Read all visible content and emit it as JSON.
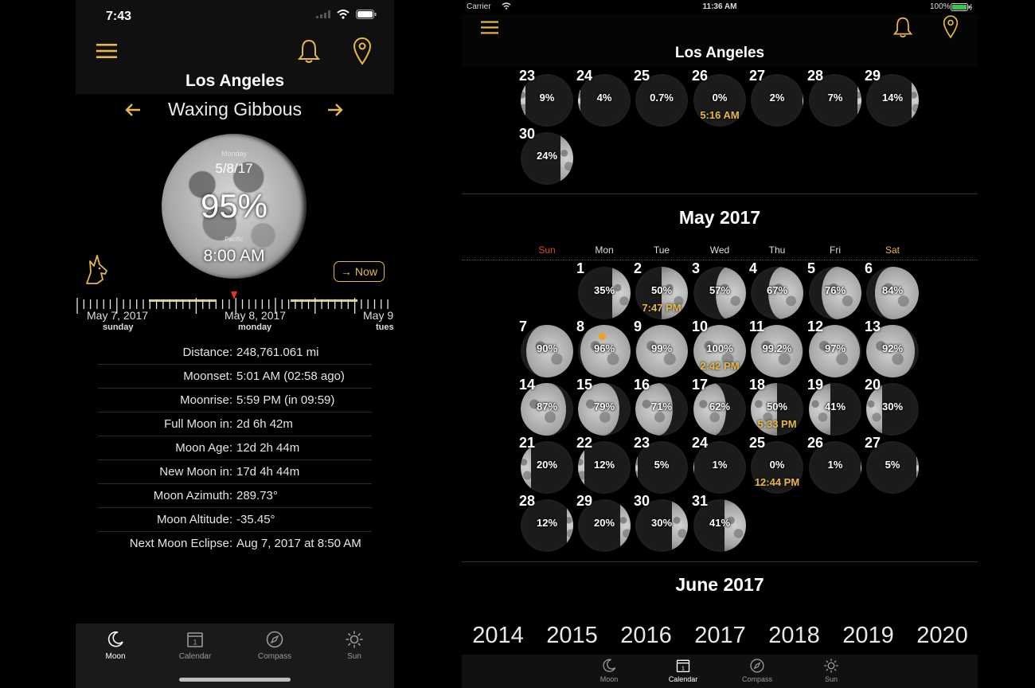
{
  "phone": {
    "status": {
      "time": "7:43"
    },
    "city": "Los Angeles",
    "phase": "Waxing Gibbous",
    "moon": {
      "day": "Monday",
      "date": "5/8/17",
      "illumination": "95%",
      "timezone": "Pacific",
      "time": "8:00 AM"
    },
    "now_button": "→ Now",
    "timeline": [
      {
        "date": "May 7, 2017",
        "day": "sunday"
      },
      {
        "date": "May 8, 2017",
        "day": "monday"
      },
      {
        "date": "May 9",
        "day": "tues"
      }
    ],
    "info": [
      {
        "label": "Distance:",
        "value": "248,761.061 mi"
      },
      {
        "label": "Moonset:",
        "value": "5:01 AM (02:58 ago)"
      },
      {
        "label": "Moonrise:",
        "value": "5:59 PM (in 09:59)"
      },
      {
        "label": "Full Moon in:",
        "value": "2d 6h 42m"
      },
      {
        "label": "Moon Age:",
        "value": "12d 2h 44m"
      },
      {
        "label": "New Moon in:",
        "value": "17d 4h 44m"
      },
      {
        "label": "Moon Azimuth:",
        "value": "289.73°"
      },
      {
        "label": "Moon Altitude:",
        "value": "-35.45°"
      },
      {
        "label": "Next Moon Eclipse:",
        "value": "Aug 7, 2017 at 8:50 AM"
      }
    ],
    "tabs": [
      {
        "label": "Moon",
        "icon": "moon-icon",
        "active": true
      },
      {
        "label": "Calendar",
        "icon": "calendar-icon",
        "active": false
      },
      {
        "label": "Compass",
        "icon": "compass-icon",
        "active": false
      },
      {
        "label": "Sun",
        "icon": "sun-icon",
        "active": false
      }
    ]
  },
  "tablet": {
    "status": {
      "carrier": "Carrier",
      "time": "11:36 AM",
      "battery": "100%"
    },
    "city": "Los Angeles",
    "april_tail": [
      {
        "day": "23",
        "pct": "9%",
        "illum": 0.09,
        "wax": false
      },
      {
        "day": "24",
        "pct": "4%",
        "illum": 0.04,
        "wax": false
      },
      {
        "day": "25",
        "pct": "0.7%",
        "illum": 0.007,
        "wax": false
      },
      {
        "day": "26",
        "pct": "0%",
        "illum": 0.0,
        "wax": true,
        "time": "5:16 AM"
      },
      {
        "day": "27",
        "pct": "2%",
        "illum": 0.02,
        "wax": true
      },
      {
        "day": "28",
        "pct": "7%",
        "illum": 0.07,
        "wax": true
      },
      {
        "day": "29",
        "pct": "14%",
        "illum": 0.14,
        "wax": true
      },
      {
        "day": "30",
        "pct": "24%",
        "illum": 0.24,
        "wax": true
      }
    ],
    "may": {
      "title": "May 2017",
      "weekdays": [
        "Sun",
        "Mon",
        "Tue",
        "Wed",
        "Thu",
        "Fri",
        "Sat"
      ],
      "first_weekday": 1,
      "days": [
        {
          "day": "1",
          "pct": "35%",
          "illum": 0.35,
          "wax": true
        },
        {
          "day": "2",
          "pct": "50%",
          "illum": 0.5,
          "wax": true,
          "time": "7:47 PM"
        },
        {
          "day": "3",
          "pct": "57%",
          "illum": 0.57,
          "wax": true
        },
        {
          "day": "4",
          "pct": "67%",
          "illum": 0.67,
          "wax": true
        },
        {
          "day": "5",
          "pct": "76%",
          "illum": 0.76,
          "wax": true
        },
        {
          "day": "6",
          "pct": "84%",
          "illum": 0.84,
          "wax": true
        },
        {
          "day": "7",
          "pct": "90%",
          "illum": 0.9,
          "wax": true
        },
        {
          "day": "8",
          "pct": "96%",
          "illum": 0.96,
          "wax": true,
          "today": true
        },
        {
          "day": "9",
          "pct": "99%",
          "illum": 0.99,
          "wax": true
        },
        {
          "day": "10",
          "pct": "100%",
          "illum": 1.0,
          "wax": true,
          "time": "2:42 PM"
        },
        {
          "day": "11",
          "pct": "99.2%",
          "illum": 0.99,
          "wax": false
        },
        {
          "day": "12",
          "pct": "97%",
          "illum": 0.97,
          "wax": false
        },
        {
          "day": "13",
          "pct": "92%",
          "illum": 0.92,
          "wax": false
        },
        {
          "day": "14",
          "pct": "87%",
          "illum": 0.87,
          "wax": false
        },
        {
          "day": "15",
          "pct": "79%",
          "illum": 0.79,
          "wax": false
        },
        {
          "day": "16",
          "pct": "71%",
          "illum": 0.71,
          "wax": false
        },
        {
          "day": "17",
          "pct": "62%",
          "illum": 0.62,
          "wax": false
        },
        {
          "day": "18",
          "pct": "50%",
          "illum": 0.5,
          "wax": false,
          "time": "5:33 PM"
        },
        {
          "day": "19",
          "pct": "41%",
          "illum": 0.41,
          "wax": false
        },
        {
          "day": "20",
          "pct": "30%",
          "illum": 0.3,
          "wax": false
        },
        {
          "day": "21",
          "pct": "20%",
          "illum": 0.2,
          "wax": false
        },
        {
          "day": "22",
          "pct": "12%",
          "illum": 0.12,
          "wax": false
        },
        {
          "day": "23",
          "pct": "5%",
          "illum": 0.05,
          "wax": false
        },
        {
          "day": "24",
          "pct": "1%",
          "illum": 0.01,
          "wax": false
        },
        {
          "day": "25",
          "pct": "0%",
          "illum": 0.0,
          "wax": true,
          "time": "12:44 PM"
        },
        {
          "day": "26",
          "pct": "1%",
          "illum": 0.01,
          "wax": true
        },
        {
          "day": "27",
          "pct": "5%",
          "illum": 0.05,
          "wax": true
        },
        {
          "day": "28",
          "pct": "12%",
          "illum": 0.12,
          "wax": true
        },
        {
          "day": "29",
          "pct": "20%",
          "illum": 0.2,
          "wax": true
        },
        {
          "day": "30",
          "pct": "30%",
          "illum": 0.3,
          "wax": true
        },
        {
          "day": "31",
          "pct": "41%",
          "illum": 0.41,
          "wax": true
        }
      ]
    },
    "june_title": "June 2017",
    "years": [
      "2014",
      "2015",
      "2016",
      "2017",
      "2018",
      "2019",
      "2020"
    ],
    "tabs": [
      {
        "label": "Moon",
        "icon": "moon-icon",
        "active": false
      },
      {
        "label": "Calendar",
        "icon": "calendar-icon",
        "active": true
      },
      {
        "label": "Compass",
        "icon": "compass-icon",
        "active": false
      },
      {
        "label": "Sun",
        "icon": "sun-icon",
        "active": false
      }
    ]
  },
  "colors": {
    "accent": "#e6b84a",
    "sunday": "#e0453a",
    "saturday": "#e6b84a",
    "today_dot": "#f0a020"
  }
}
